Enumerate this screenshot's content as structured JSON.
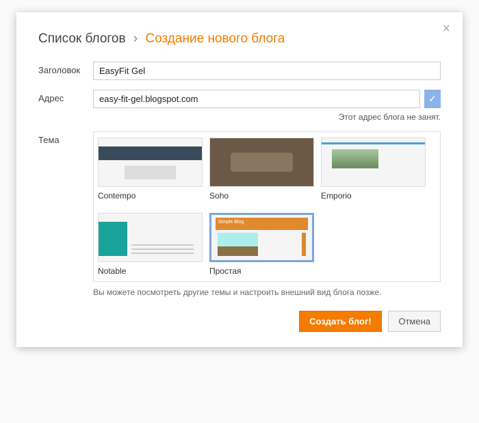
{
  "breadcrumb": {
    "list_label": "Список блогов",
    "separator": "›",
    "current": "Создание нового блога"
  },
  "form": {
    "title_label": "Заголовок",
    "title_value": "EasyFit Gel",
    "address_label": "Адрес",
    "address_value": "easy-fit-gel.blogspot.com",
    "address_status": "Этот адрес блога не занят.",
    "address_check_icon": "✓",
    "theme_label": "Тема",
    "theme_hint": "Вы можете посмотреть другие темы и настроить внешний вид блога позже."
  },
  "themes": [
    {
      "name": "Contempo",
      "selected": false
    },
    {
      "name": "Soho",
      "selected": false
    },
    {
      "name": "Emporio",
      "selected": false
    },
    {
      "name": "Notable",
      "selected": false
    },
    {
      "name": "Простая",
      "selected": true,
      "thumb_title": "Simple Blog"
    }
  ],
  "actions": {
    "create": "Создать блог!",
    "cancel": "Отмена"
  },
  "icons": {
    "close": "×"
  }
}
